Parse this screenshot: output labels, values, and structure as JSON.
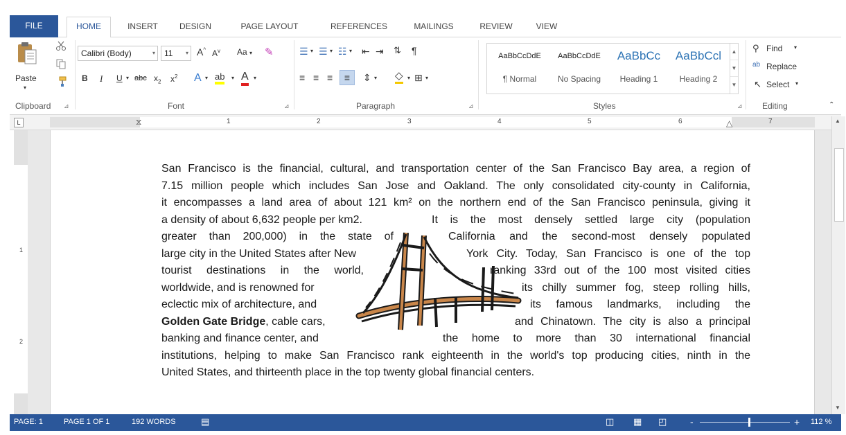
{
  "tabs": {
    "file": "FILE",
    "home": "HOME",
    "insert": "INSERT",
    "design": "DESIGN",
    "page_layout": "PAGE LAYOUT",
    "references": "REFERENCES",
    "mailings": "MAILINGS",
    "review": "REVIEW",
    "view": "VIEW"
  },
  "clipboard": {
    "paste": "Paste",
    "group": "Clipboard"
  },
  "font": {
    "name": "Calibri (Body)",
    "size": "11",
    "change_case": "Aa",
    "group": "Font"
  },
  "paragraph": {
    "group": "Paragraph"
  },
  "styles": {
    "group": "Styles",
    "items": [
      {
        "preview": "AaBbCcDdE",
        "name": "¶ Normal"
      },
      {
        "preview": "AaBbCcDdE",
        "name": "No Spacing"
      },
      {
        "preview": "AaBbCc",
        "name": "Heading 1"
      },
      {
        "preview": "AaBbCcl",
        "name": "Heading 2"
      }
    ]
  },
  "editing": {
    "group": "Editing",
    "find": "Find",
    "replace": "Replace",
    "select": "Select"
  },
  "ruler": {
    "numbers": [
      "1",
      "2",
      "3",
      "4",
      "5",
      "6",
      "7"
    ],
    "vertical": [
      "1",
      "2"
    ]
  },
  "document": {
    "lines": [
      "San Francisco is the financial, cultural, and transportation center of the San Francisco Bay area, a region of",
      "7.15 million people which includes San Jose and Oakland. The only consolidated city-county in California,",
      "it encompasses a land area of about 121 km² on the northern end of the San Francisco peninsula, giving it"
    ],
    "wrap": [
      {
        "left": "a density of about 6,632 people per km2.",
        "right": "It is the most densely settled large city (population"
      },
      {
        "left": "greater than 200,000) in the state of",
        "right": "California and the second-most densely populated"
      },
      {
        "left": "large city in the United States after New",
        "right": "York City. Today, San Francisco is one of the top"
      },
      {
        "left": "tourist destinations in the world,",
        "right": "ranking 33rd out of the 100 most visited cities"
      },
      {
        "left": "worldwide, and is renowned for",
        "right": "its chilly summer fog, steep rolling hills,"
      },
      {
        "left": "eclectic mix of architecture, and",
        "right": "its famous landmarks, including the"
      },
      {
        "left_bold": "Golden Gate Bridge",
        "left_rest": ", cable cars,",
        "right": "and Chinatown.  The city is also a principal"
      },
      {
        "left": "banking and finance center, and",
        "right": "the home to more than 30 international financial"
      }
    ],
    "tail": [
      "institutions, helping to make San Francisco rank eighteenth in the world's top producing cities, ninth in the",
      "United States, and thirteenth place in the top twenty global financial centers."
    ]
  },
  "status": {
    "page": "PAGE: 1",
    "page_of": "PAGE 1 OF 1",
    "words": "192 WORDS",
    "zoom_minus": "-",
    "zoom_plus": "+",
    "zoom": "112 %"
  },
  "colors": {
    "accent": "#2b579a",
    "heading_style": "#2e74b5"
  }
}
